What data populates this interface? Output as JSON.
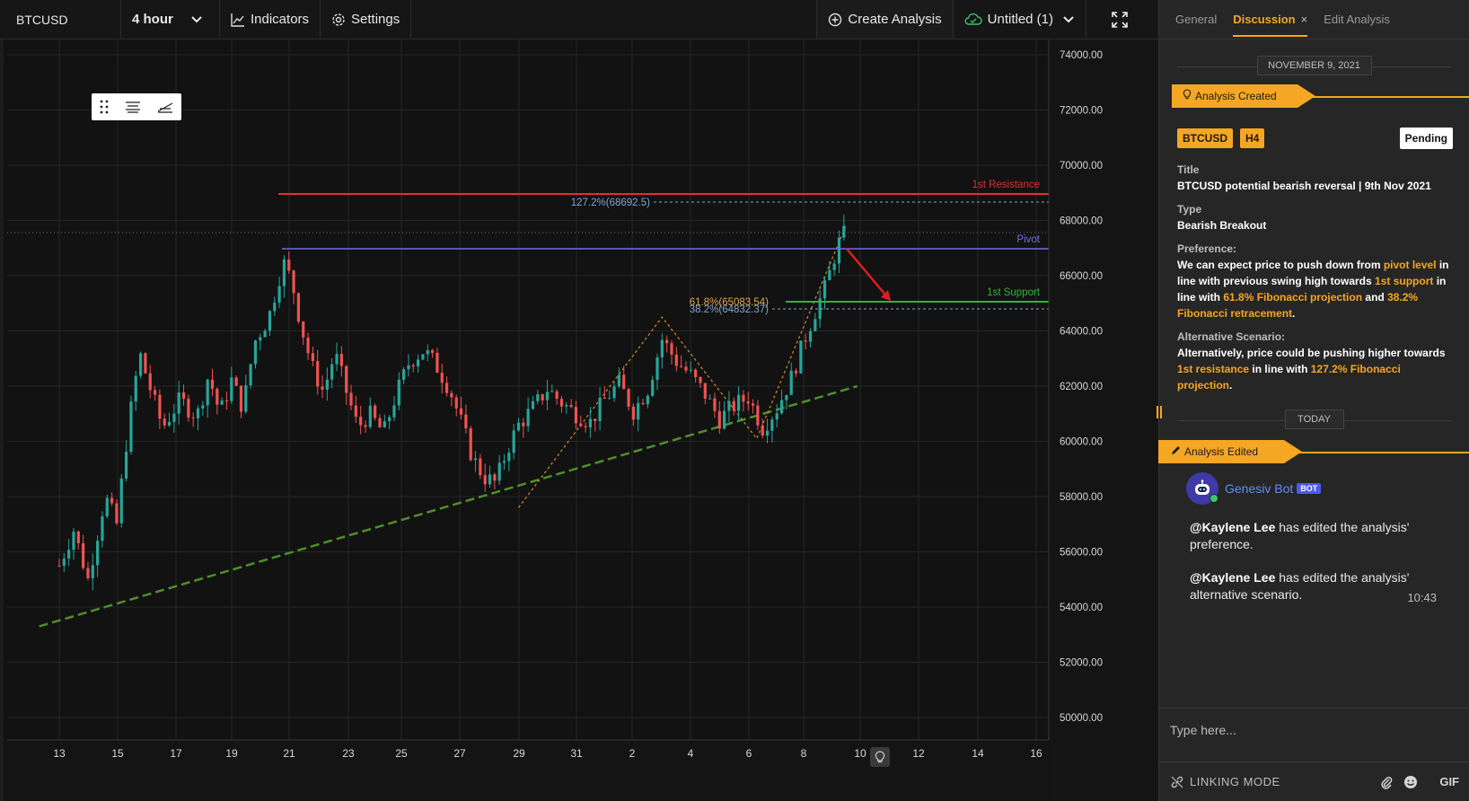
{
  "toolbar": {
    "symbol": "BTCUSD",
    "interval": "4 hour",
    "indicators_label": "Indicators",
    "settings_label": "Settings",
    "create_analysis_label": "Create Analysis",
    "layout_name": "Untitled (1)"
  },
  "chart_data": {
    "type": "candlestick",
    "symbol": "BTCUSD",
    "interval": "4 hour",
    "ylim": [
      49500,
      74500
    ],
    "y_ticks": [
      "74000.00",
      "72000.00",
      "70000.00",
      "68000.00",
      "66000.00",
      "64000.00",
      "62000.00",
      "60000.00",
      "58000.00",
      "56000.00",
      "54000.00",
      "52000.00",
      "50000.00"
    ],
    "x_ticks": [
      "13",
      "15",
      "17",
      "19",
      "21",
      "23",
      "25",
      "27",
      "29",
      "31",
      "2",
      "4",
      "6",
      "8",
      "10",
      "12",
      "14",
      "16"
    ],
    "levels": [
      {
        "label": "1st Resistance",
        "value": "68949.25",
        "color": "#e62e2e"
      },
      {
        "label": "127.2%(68692.5)",
        "value": "",
        "color": "#7ea6cf"
      },
      {
        "label": "",
        "value": "67599.40",
        "color": "#2aa198"
      },
      {
        "label": "Pivot",
        "value": "67010.04",
        "color": "#6f6fe0"
      },
      {
        "label": "1st Support",
        "value": "65105.39",
        "color": "#2db82d"
      },
      {
        "label": "61.8%(65083.54)",
        "value": "",
        "color": "#e0a84a"
      },
      {
        "label": "38.2%(64832.37)",
        "value": "",
        "color": "#7ea6cf"
      }
    ],
    "candle_path": [
      [
        13,
        55500
      ],
      [
        13.5,
        56800
      ],
      [
        14,
        55000
      ],
      [
        14.6,
        58000
      ],
      [
        15,
        57000
      ],
      [
        15.4,
        60500
      ],
      [
        15.8,
        63200
      ],
      [
        16.2,
        61800
      ],
      [
        16.6,
        60500
      ],
      [
        17.2,
        61500
      ],
      [
        17.8,
        60900
      ],
      [
        18.2,
        62400
      ],
      [
        18.6,
        61000
      ],
      [
        19,
        62200
      ],
      [
        19.4,
        61200
      ],
      [
        19.8,
        63600
      ],
      [
        20.3,
        64500
      ],
      [
        20.8,
        66500
      ],
      [
        21.1,
        65800
      ],
      [
        21.4,
        64300
      ],
      [
        21.8,
        62700
      ],
      [
        22.2,
        61800
      ],
      [
        22.6,
        63200
      ],
      [
        23,
        61800
      ],
      [
        23.4,
        60500
      ],
      [
        23.8,
        61000
      ],
      [
        24.3,
        60300
      ],
      [
        24.7,
        61600
      ],
      [
        25.2,
        62900
      ],
      [
        25.7,
        63300
      ],
      [
        26.1,
        62800
      ],
      [
        26.6,
        61900
      ],
      [
        27,
        60700
      ],
      [
        27.4,
        59400
      ],
      [
        27.8,
        58700
      ],
      [
        28.2,
        58500
      ],
      [
        28.6,
        59700
      ],
      [
        29,
        60600
      ],
      [
        29.5,
        61200
      ],
      [
        30,
        61900
      ],
      [
        30.5,
        61400
      ],
      [
        31,
        61000
      ],
      [
        31.5,
        60700
      ],
      [
        32,
        61500
      ],
      [
        32.5,
        62100
      ],
      [
        33,
        61100
      ],
      [
        33.5,
        61900
      ],
      [
        34,
        63700
      ],
      [
        34.5,
        62900
      ],
      [
        35,
        62400
      ],
      [
        35.5,
        61700
      ],
      [
        36,
        60800
      ],
      [
        36.5,
        61300
      ],
      [
        37,
        61600
      ],
      [
        37.5,
        60500
      ],
      [
        38,
        61200
      ],
      [
        38.5,
        62300
      ],
      [
        39,
        63800
      ],
      [
        39.4,
        64900
      ],
      [
        39.7,
        65600
      ],
      [
        40,
        66700
      ],
      [
        40.2,
        67300
      ],
      [
        40.35,
        67500
      ]
    ],
    "trend_line": [
      [
        12.3,
        53300
      ],
      [
        40.8,
        62000
      ]
    ],
    "projection_arrow": [
      [
        40.4,
        67000
      ],
      [
        41.5,
        65100
      ]
    ]
  },
  "panel": {
    "tabs": [
      {
        "label": "General"
      },
      {
        "label": "Discussion",
        "close": "×"
      },
      {
        "label": "Edit Analysis"
      }
    ],
    "date_sep_1": "NOVEMBER 9, 2021",
    "event_created": "Analysis Created",
    "badges": [
      "BTCUSD",
      "H4"
    ],
    "status": "Pending",
    "title_label": "Title",
    "title_value": "BTCUSD potential bearish reversal | 9th Nov 2021",
    "type_label": "Type",
    "type_value": "Bearish Breakout",
    "preference_label": "Preference:",
    "pref": {
      "t1": "We can expect price to push down from ",
      "h1": "pivot level",
      "t2": " in line with previous swing high towards ",
      "h2": "1st support",
      "t3": " in line with ",
      "h3": "61.8% Fibonacci projection",
      "t4": " and ",
      "h4": "38.2% Fibonacci retracement",
      "t5": "."
    },
    "alt_label": "Alternative Scenario:",
    "alt": {
      "t1": "Alternatively, price could be pushing higher towards ",
      "h1": "1st resistance",
      "t2": " in line with ",
      "h2": "127.2% Fibonacci projection",
      "t3": "."
    },
    "date_sep_2": "TODAY",
    "event_edited": "Analysis Edited",
    "bot_name": "Genesiv Bot",
    "bot_badge": "BOT",
    "msg1": {
      "mention": "@Kaylene Lee",
      "text": " has edited the analysis' preference."
    },
    "msg2": {
      "mention": "@Kaylene Lee",
      "text": " has edited the analysis' alternative scenario."
    },
    "msg_time": "10:43",
    "input_placeholder": "Type here...",
    "linking_mode": "LINKING MODE",
    "gif_label": "GIF"
  }
}
